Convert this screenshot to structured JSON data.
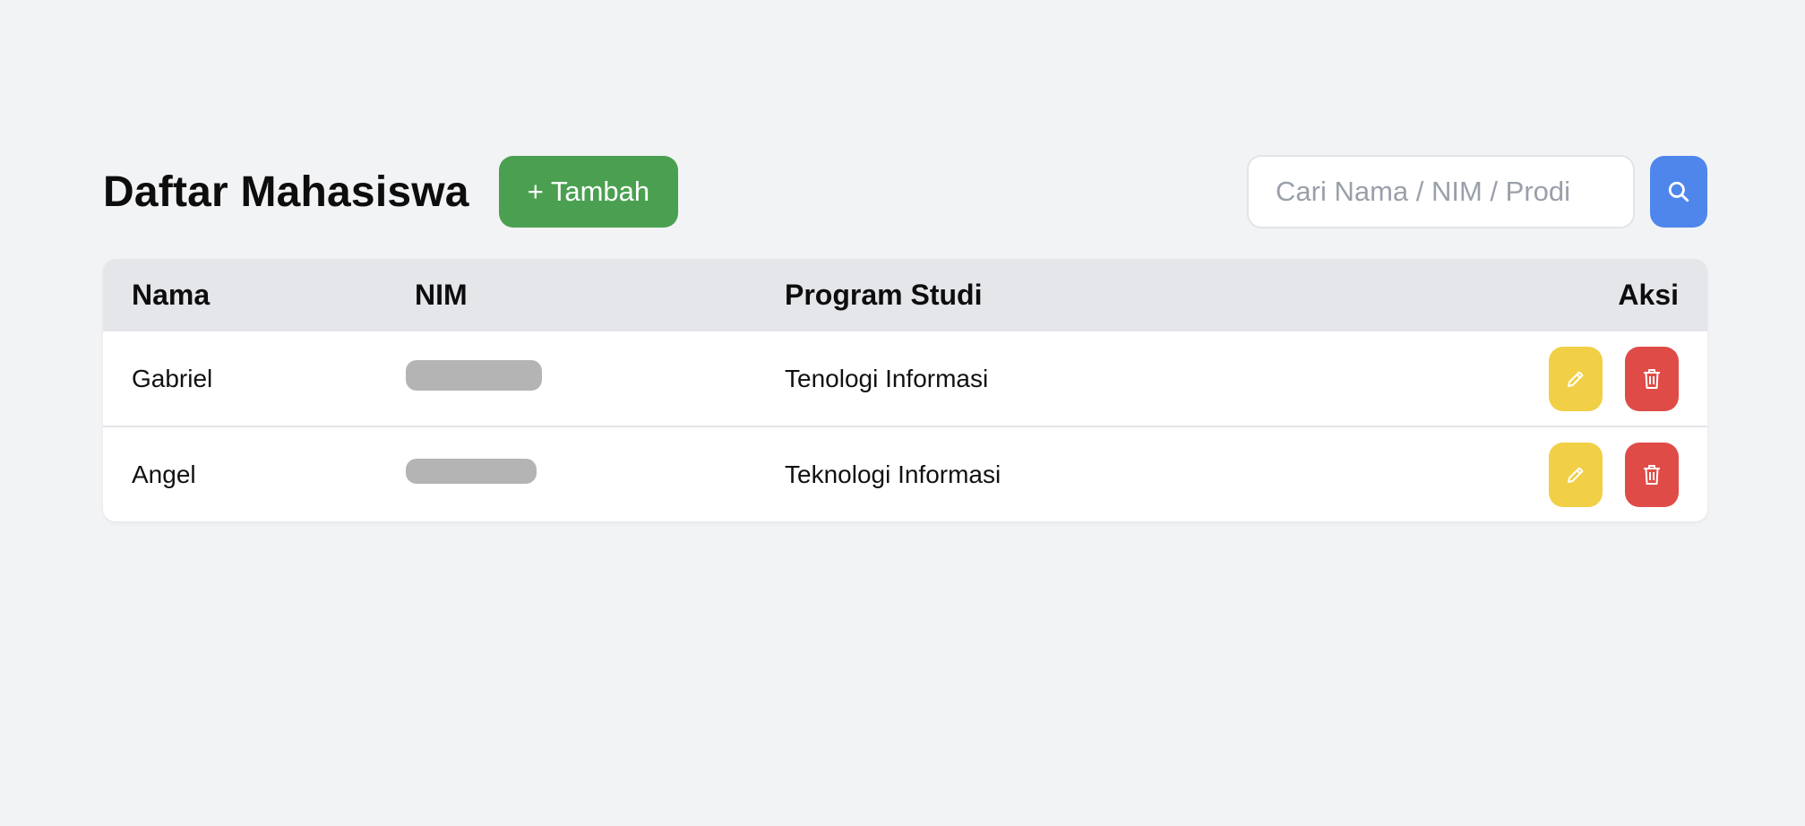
{
  "header": {
    "title": "Daftar Mahasiswa",
    "add_label": "+ Tambah",
    "search_placeholder": "Cari Nama / NIM / Prodi",
    "search_icon": "search-icon"
  },
  "table": {
    "columns": [
      "Nama",
      "NIM",
      "Program Studi",
      "Aksi"
    ],
    "rows": [
      {
        "nama": "Gabriel",
        "nim": "",
        "prodi": "Tenologi Informasi"
      },
      {
        "nama": "Angel",
        "nim": "",
        "prodi": "Teknologi Informasi"
      }
    ],
    "row_actions": [
      "pencil-icon",
      "trash-icon"
    ]
  },
  "colors": {
    "background": "#f2f3f5",
    "add_button": "#4aa050",
    "search_button": "#4f86ec",
    "edit_button": "#f1cf46",
    "delete_button": "#df4c47",
    "table_header": "#e5e6ea"
  }
}
